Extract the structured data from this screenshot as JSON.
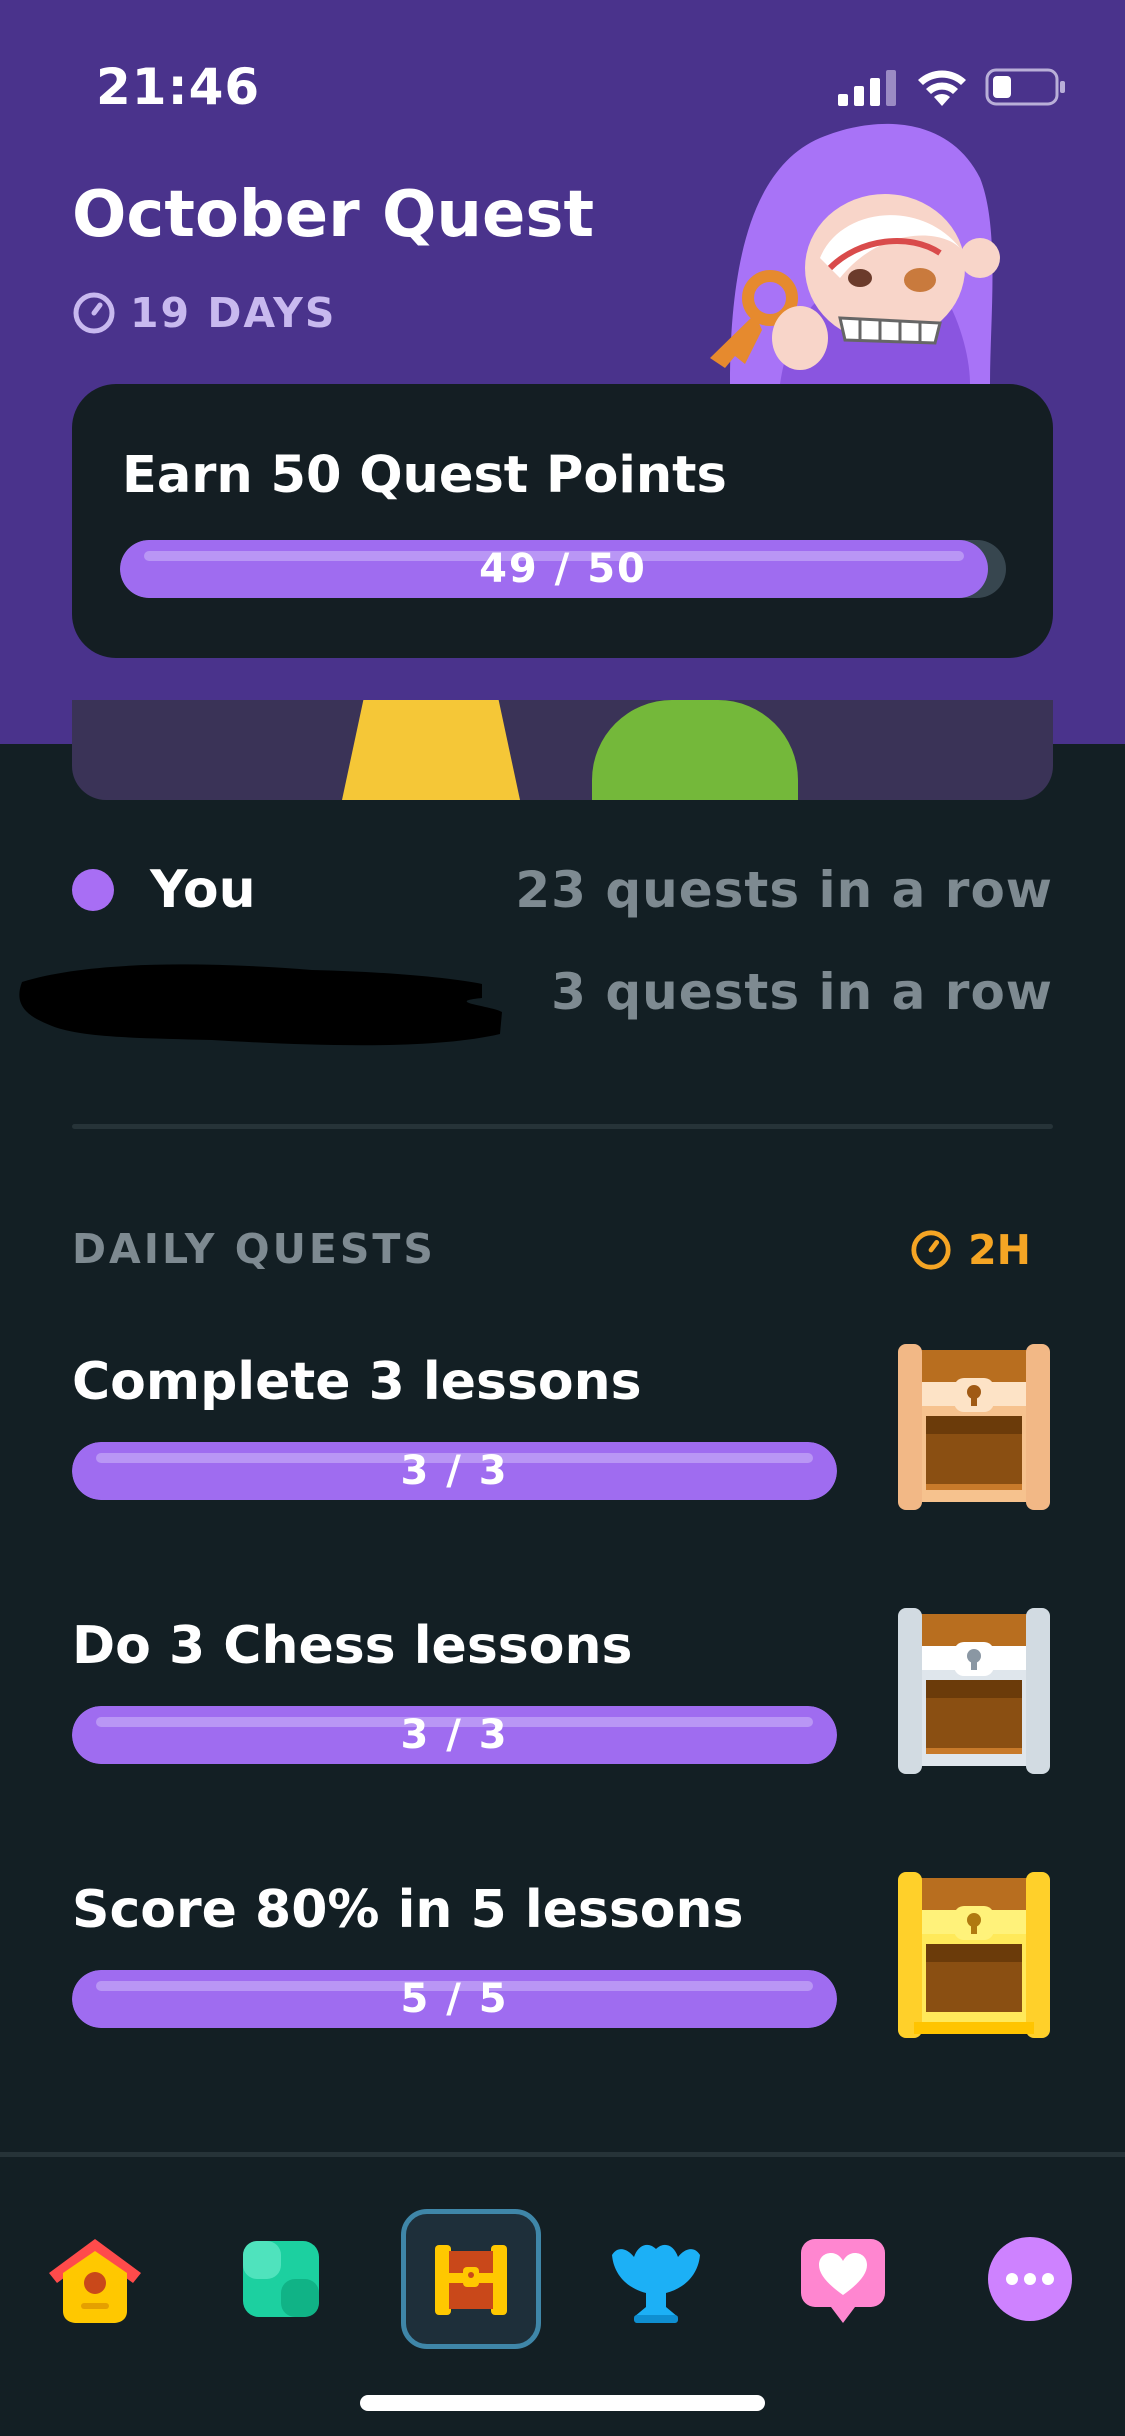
{
  "status_bar": {
    "time": "21:46"
  },
  "header": {
    "title": "October Quest",
    "days_left": "19 DAYS",
    "quest_card": {
      "label": "Earn 50 Quest Points",
      "progress_text": "49 / 50",
      "progress_fraction": 0.98
    }
  },
  "friends": {
    "you": {
      "name": "You",
      "streak": "23 quests in a row"
    },
    "friend": {
      "streak": "3 quests in a row"
    }
  },
  "daily": {
    "heading": "DAILY QUESTS",
    "timer": "2H",
    "quests": [
      {
        "label": "Complete 3 lessons",
        "progress_text": "3 / 3",
        "progress_fraction": 1.0,
        "chest": "bronze-chest-icon"
      },
      {
        "label": "Do 3 Chess lessons",
        "progress_text": "3 / 3",
        "progress_fraction": 1.0,
        "chest": "silver-chest-icon"
      },
      {
        "label": "Score 80% in 5 lessons",
        "progress_text": "5 / 5",
        "progress_fraction": 1.0,
        "chest": "gold-chest-icon"
      }
    ]
  },
  "nav": {
    "items": [
      {
        "name": "home",
        "icon": "home-icon"
      },
      {
        "name": "practice",
        "icon": "practice-grid-icon"
      },
      {
        "name": "quests",
        "icon": "quest-chest-icon",
        "active": true
      },
      {
        "name": "leagues",
        "icon": "trophy-icon"
      },
      {
        "name": "shop",
        "icon": "heart-shop-icon"
      },
      {
        "name": "more",
        "icon": "more-dots-icon"
      }
    ]
  },
  "colors": {
    "header_bg": "#4a338c",
    "page_bg": "#131f24",
    "progress_purple": "#9f6cf0",
    "timer_orange": "#f5a524",
    "muted_text": "#7e8a91"
  }
}
